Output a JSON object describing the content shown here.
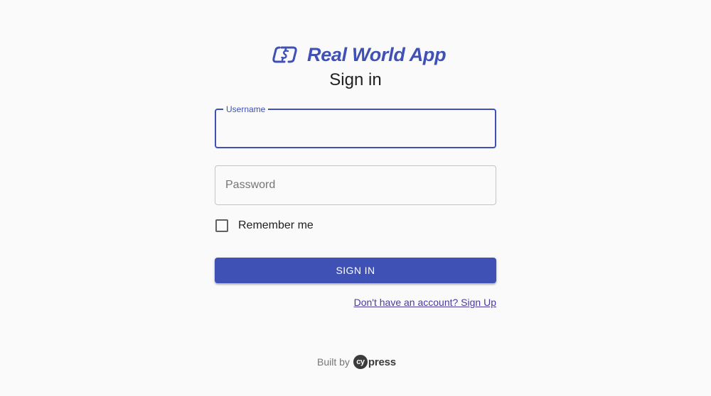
{
  "app": {
    "name": "Real World App",
    "logo_icon": "dollar-exchange-icon",
    "brand_color": "#3f51b5"
  },
  "signin": {
    "title": "Sign in",
    "username": {
      "label": "Username",
      "value": ""
    },
    "password": {
      "placeholder": "Password",
      "value": ""
    },
    "remember": {
      "label": "Remember me",
      "checked": false
    },
    "submit_label": "SIGN IN",
    "signup_link": "Don't have an account? Sign Up"
  },
  "footer": {
    "built_by": "Built by",
    "brand": {
      "cy": "cy",
      "press": "press"
    }
  }
}
